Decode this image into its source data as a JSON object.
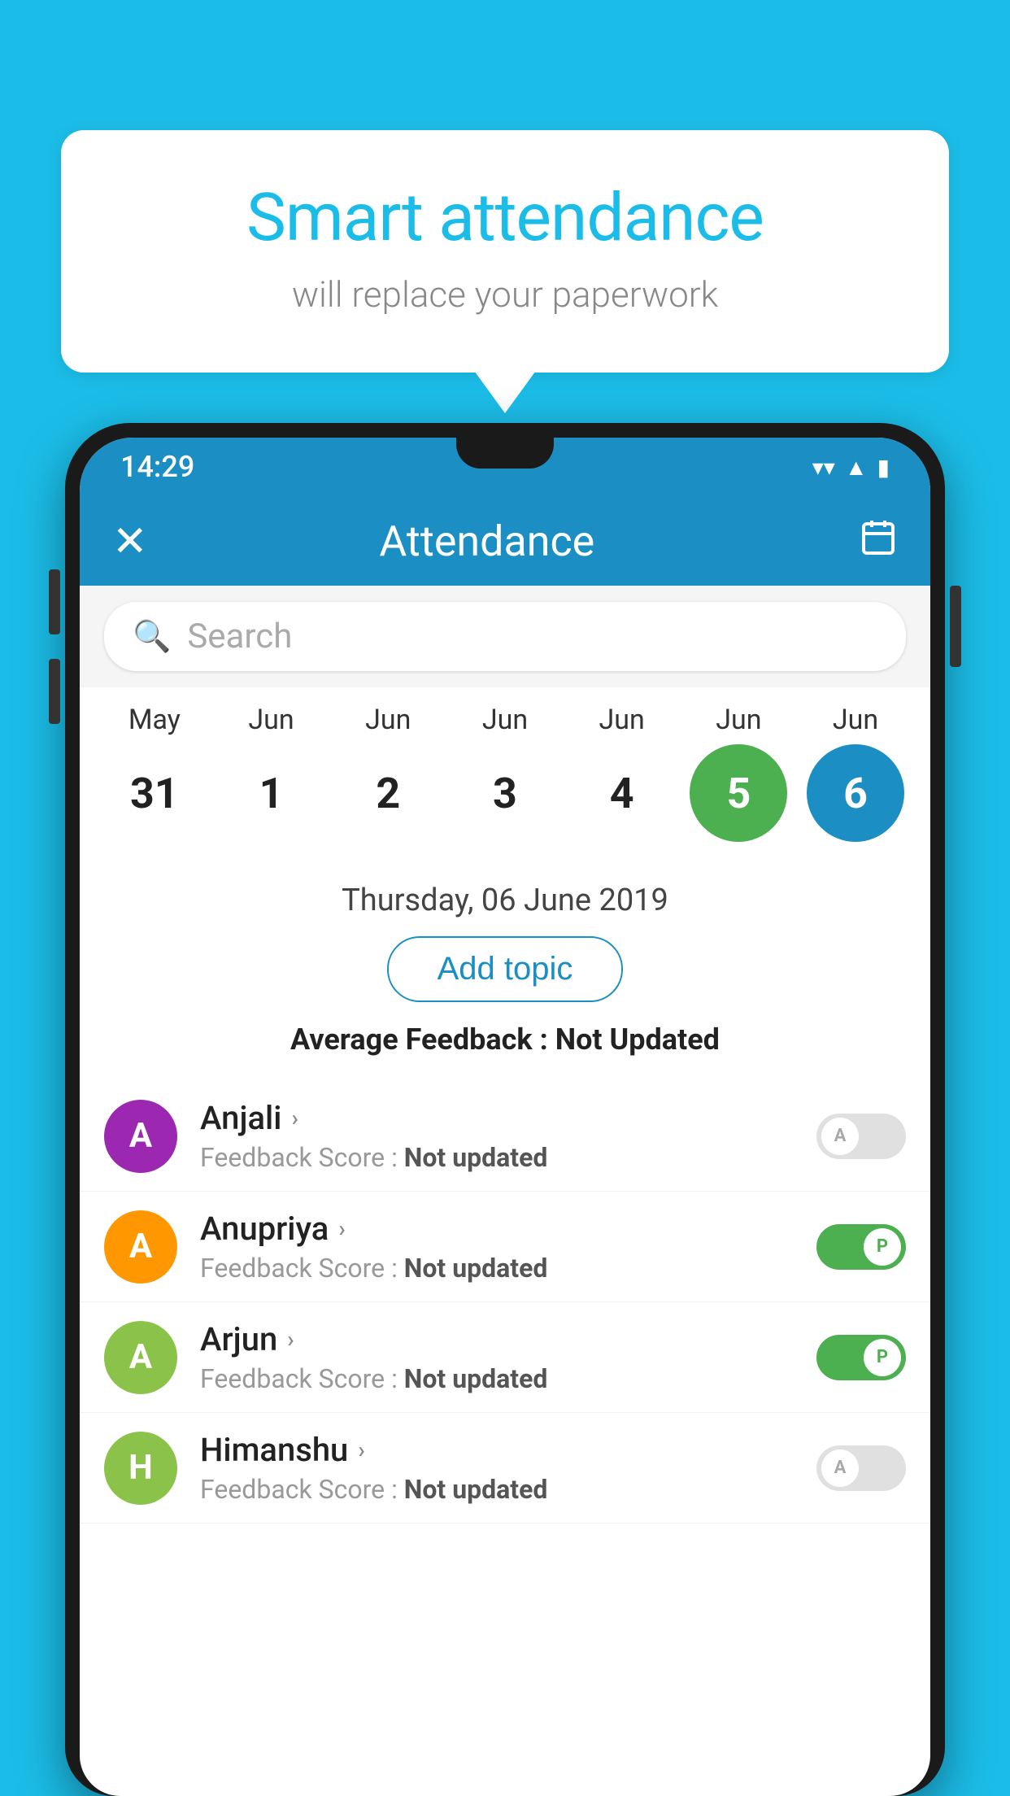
{
  "background_color": "#1BBDE8",
  "bubble": {
    "title": "Smart attendance",
    "subtitle": "will replace your paperwork"
  },
  "status_bar": {
    "time": "14:29"
  },
  "app_bar": {
    "title": "Attendance",
    "close_label": "✕",
    "calendar_label": "📅"
  },
  "search": {
    "placeholder": "Search"
  },
  "calendar": {
    "columns": [
      {
        "month": "May",
        "date": "31",
        "state": "normal"
      },
      {
        "month": "Jun",
        "date": "1",
        "state": "normal"
      },
      {
        "month": "Jun",
        "date": "2",
        "state": "normal"
      },
      {
        "month": "Jun",
        "date": "3",
        "state": "normal"
      },
      {
        "month": "Jun",
        "date": "4",
        "state": "normal"
      },
      {
        "month": "Jun",
        "date": "5",
        "state": "selected-green"
      },
      {
        "month": "Jun",
        "date": "6",
        "state": "selected-blue"
      }
    ]
  },
  "selected_date": "Thursday, 06 June 2019",
  "add_topic_label": "Add topic",
  "average_feedback": {
    "label": "Average Feedback : ",
    "value": "Not Updated"
  },
  "students": [
    {
      "name": "Anjali",
      "avatar_letter": "A",
      "avatar_color": "purple",
      "feedback_label": "Feedback Score : ",
      "feedback_value": "Not updated",
      "toggle_state": "off",
      "toggle_letter": "A"
    },
    {
      "name": "Anupriya",
      "avatar_letter": "A",
      "avatar_color": "orange",
      "feedback_label": "Feedback Score : ",
      "feedback_value": "Not updated",
      "toggle_state": "on",
      "toggle_letter": "P"
    },
    {
      "name": "Arjun",
      "avatar_letter": "A",
      "avatar_color": "green",
      "feedback_label": "Feedback Score : ",
      "feedback_value": "Not updated",
      "toggle_state": "on",
      "toggle_letter": "P"
    },
    {
      "name": "Himanshu",
      "avatar_letter": "H",
      "avatar_color": "green-dark",
      "feedback_label": "Feedback Score : ",
      "feedback_value": "Not updated",
      "toggle_state": "off",
      "toggle_letter": "A"
    }
  ]
}
